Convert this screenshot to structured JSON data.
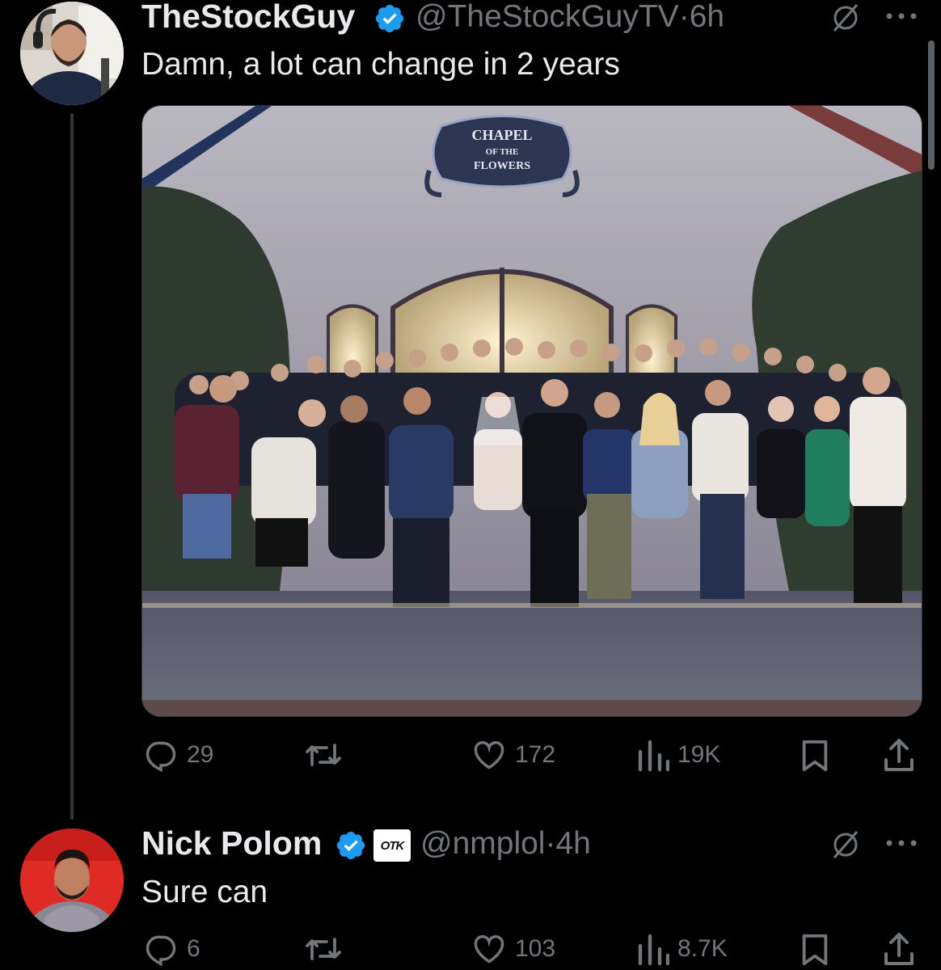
{
  "tweets": [
    {
      "display_name": "TheStockGuy",
      "handle": "@TheStockGuyTV",
      "time": "6h",
      "text": "Damn, a lot can change in 2 years",
      "media_sign": [
        "CHAPEL",
        "OF THE",
        "FLOWERS"
      ],
      "stats": {
        "replies": "29",
        "reposts": "",
        "likes": "172",
        "views": "19K"
      }
    },
    {
      "display_name": "Nick Polom",
      "handle": "@nmplol",
      "time": "4h",
      "affiliate_badge": "OTK",
      "text": "Sure can",
      "stats": {
        "replies": "6",
        "reposts": "",
        "likes": "103",
        "views": "8.7K"
      }
    }
  ],
  "separator": "·",
  "colors": {
    "background": "#000000",
    "text": "#e7e9ea",
    "muted": "#71767b",
    "verified": "#1d9bf0"
  }
}
